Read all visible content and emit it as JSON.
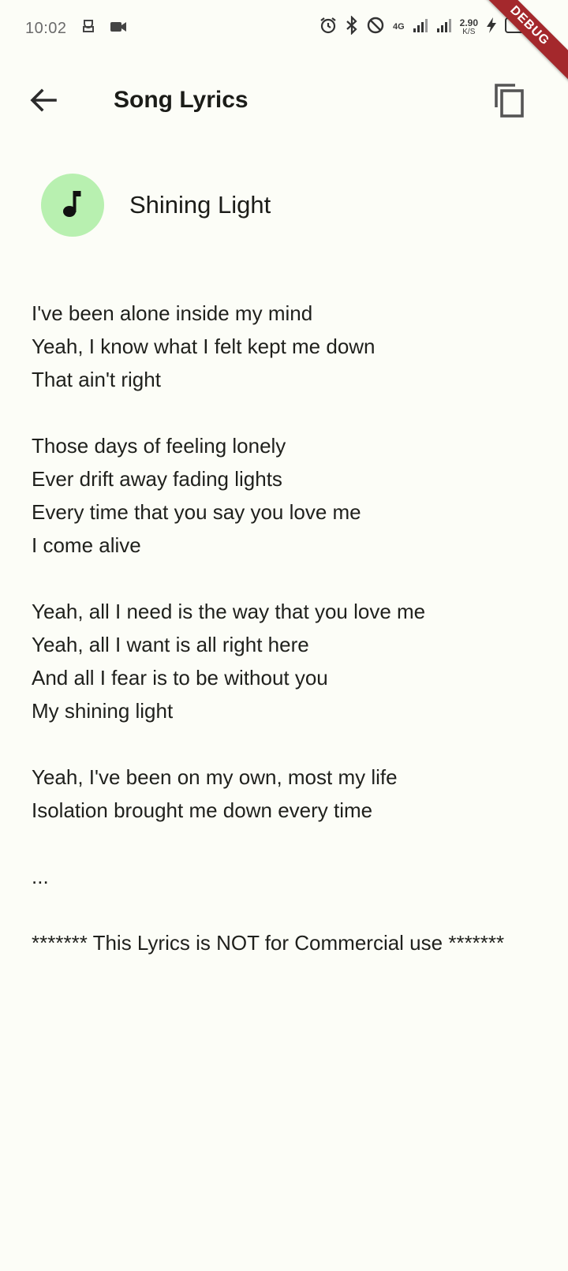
{
  "status_bar": {
    "time": "10:02",
    "network_type": "4G",
    "speed_value": "2.90",
    "speed_unit": "K/S"
  },
  "debug_banner": "DEBUG",
  "app_bar": {
    "title": "Song Lyrics"
  },
  "song": {
    "title": "Shining Light"
  },
  "lyrics": {
    "stanzas": [
      {
        "lines": [
          "I've been alone inside my mind",
          "Yeah, I know what I felt kept me down",
          "That ain't right"
        ]
      },
      {
        "lines": [
          "Those days of feeling lonely",
          "Ever drift away fading lights",
          "Every time that you say you love me",
          "I come alive"
        ]
      },
      {
        "lines": [
          "Yeah, all I need is the way that you love me",
          "Yeah, all I want is all right here",
          "And all I fear is to be without you",
          "My shining light"
        ]
      },
      {
        "lines": [
          "Yeah, I've been on my own, most my life",
          "Isolation brought me down every time"
        ]
      }
    ],
    "ellipsis": "...",
    "disclaimer": "******* This Lyrics is NOT for Commercial use *******"
  },
  "colors": {
    "background": "#fcfdf7",
    "avatar_bg": "#b8f0b0",
    "debug_banner": "#a4282c"
  }
}
